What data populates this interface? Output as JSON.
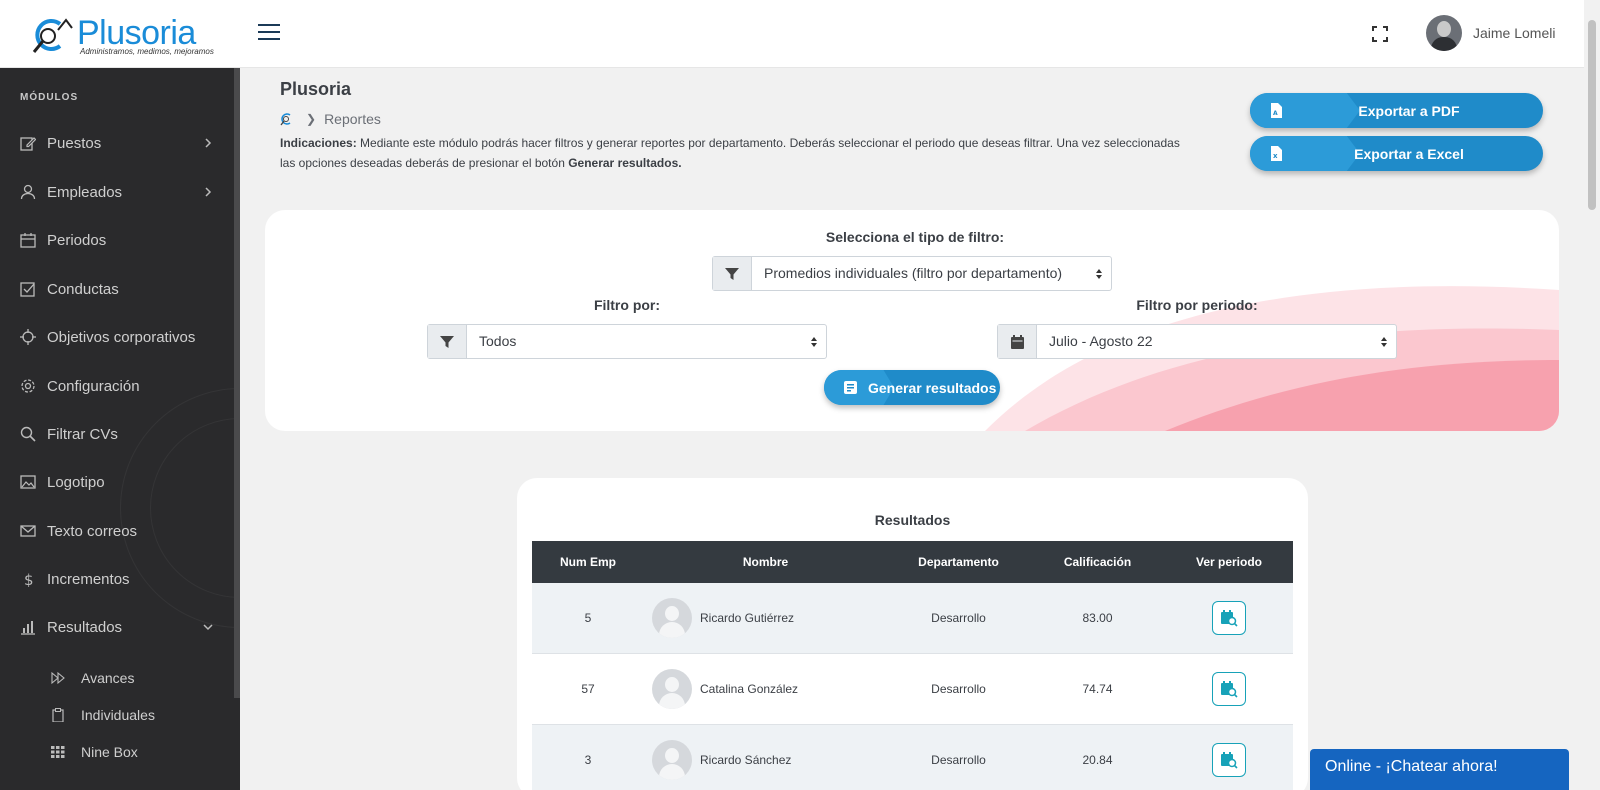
{
  "brand": {
    "name": "Plusoria",
    "tagline": "Administramos, medimos, mejoramos",
    "color": "#1a8cd8"
  },
  "header": {
    "user_name": "Jaime Lomeli",
    "menu_icon": "hamburger-icon",
    "fullscreen_icon": "expand-icon"
  },
  "sidebar": {
    "section_title": "MÓDULOS",
    "items": [
      {
        "label": "Puestos",
        "icon": "edit-icon",
        "has_children": true
      },
      {
        "label": "Empleados",
        "icon": "user-icon",
        "has_children": true
      },
      {
        "label": "Periodos",
        "icon": "calendar-icon"
      },
      {
        "label": "Conductas",
        "icon": "checkbox-icon"
      },
      {
        "label": "Objetivos corporativos",
        "icon": "target-icon"
      },
      {
        "label": "Configuración",
        "icon": "gear-icon"
      },
      {
        "label": "Filtrar CVs",
        "icon": "search-icon"
      },
      {
        "label": "Logotipo",
        "icon": "image-icon"
      },
      {
        "label": "Texto correos",
        "icon": "mail-icon"
      },
      {
        "label": "Incrementos",
        "icon": "dollar-icon"
      },
      {
        "label": "Resultados",
        "icon": "bar-chart-icon",
        "expanded": true
      }
    ],
    "subitems": [
      {
        "label": "Avances",
        "icon": "fast-forward-icon"
      },
      {
        "label": "Individuales",
        "icon": "clipboard-icon"
      },
      {
        "label": "Nine Box",
        "icon": "grid-icon"
      }
    ]
  },
  "page": {
    "title": "Plusoria",
    "breadcrumb_current": "Reportes",
    "indications_label": "Indicaciones:",
    "indications_text": " Mediante este módulo podrás hacer filtros y generar reportes por departamento. Deberás seleccionar el periodo que deseas filtrar. Una vez seleccionadas las opciones deseadas deberás de presionar el botón ",
    "indications_button": "Generar resultados."
  },
  "exports": {
    "pdf_label": "Exportar a PDF",
    "excel_label": "Exportar a Excel"
  },
  "filters": {
    "type_label": "Selecciona el tipo de filtro:",
    "type_value": "Promedios individuales (filtro por departamento)",
    "by_label": "Filtro por:",
    "by_value": "Todos",
    "period_label": "Filtro por periodo:",
    "period_value": "Julio - Agosto 22",
    "generate_label": "Generar resultados"
  },
  "results": {
    "title": "Resultados",
    "columns": [
      "Num Emp",
      "Nombre",
      "Departamento",
      "Calificación",
      "Ver periodo"
    ],
    "rows": [
      {
        "num": "5",
        "name": "Ricardo Gutiérrez",
        "dept": "Desarrollo",
        "score": "83.00"
      },
      {
        "num": "57",
        "name": "Catalina González",
        "dept": "Desarrollo",
        "score": "74.74"
      },
      {
        "num": "3",
        "name": "Ricardo Sánchez",
        "dept": "Desarrollo",
        "score": "20.84"
      }
    ]
  },
  "chat": {
    "label": "Online - ¡Chatear ahora!",
    "color": "#1565c0"
  },
  "colors": {
    "accent": "#1f8bc9",
    "sidebar_bg": "#2a2a2c",
    "table_header": "#343a40",
    "wave_pink": "#f7a1ae",
    "view_button": "#17a2b8"
  }
}
